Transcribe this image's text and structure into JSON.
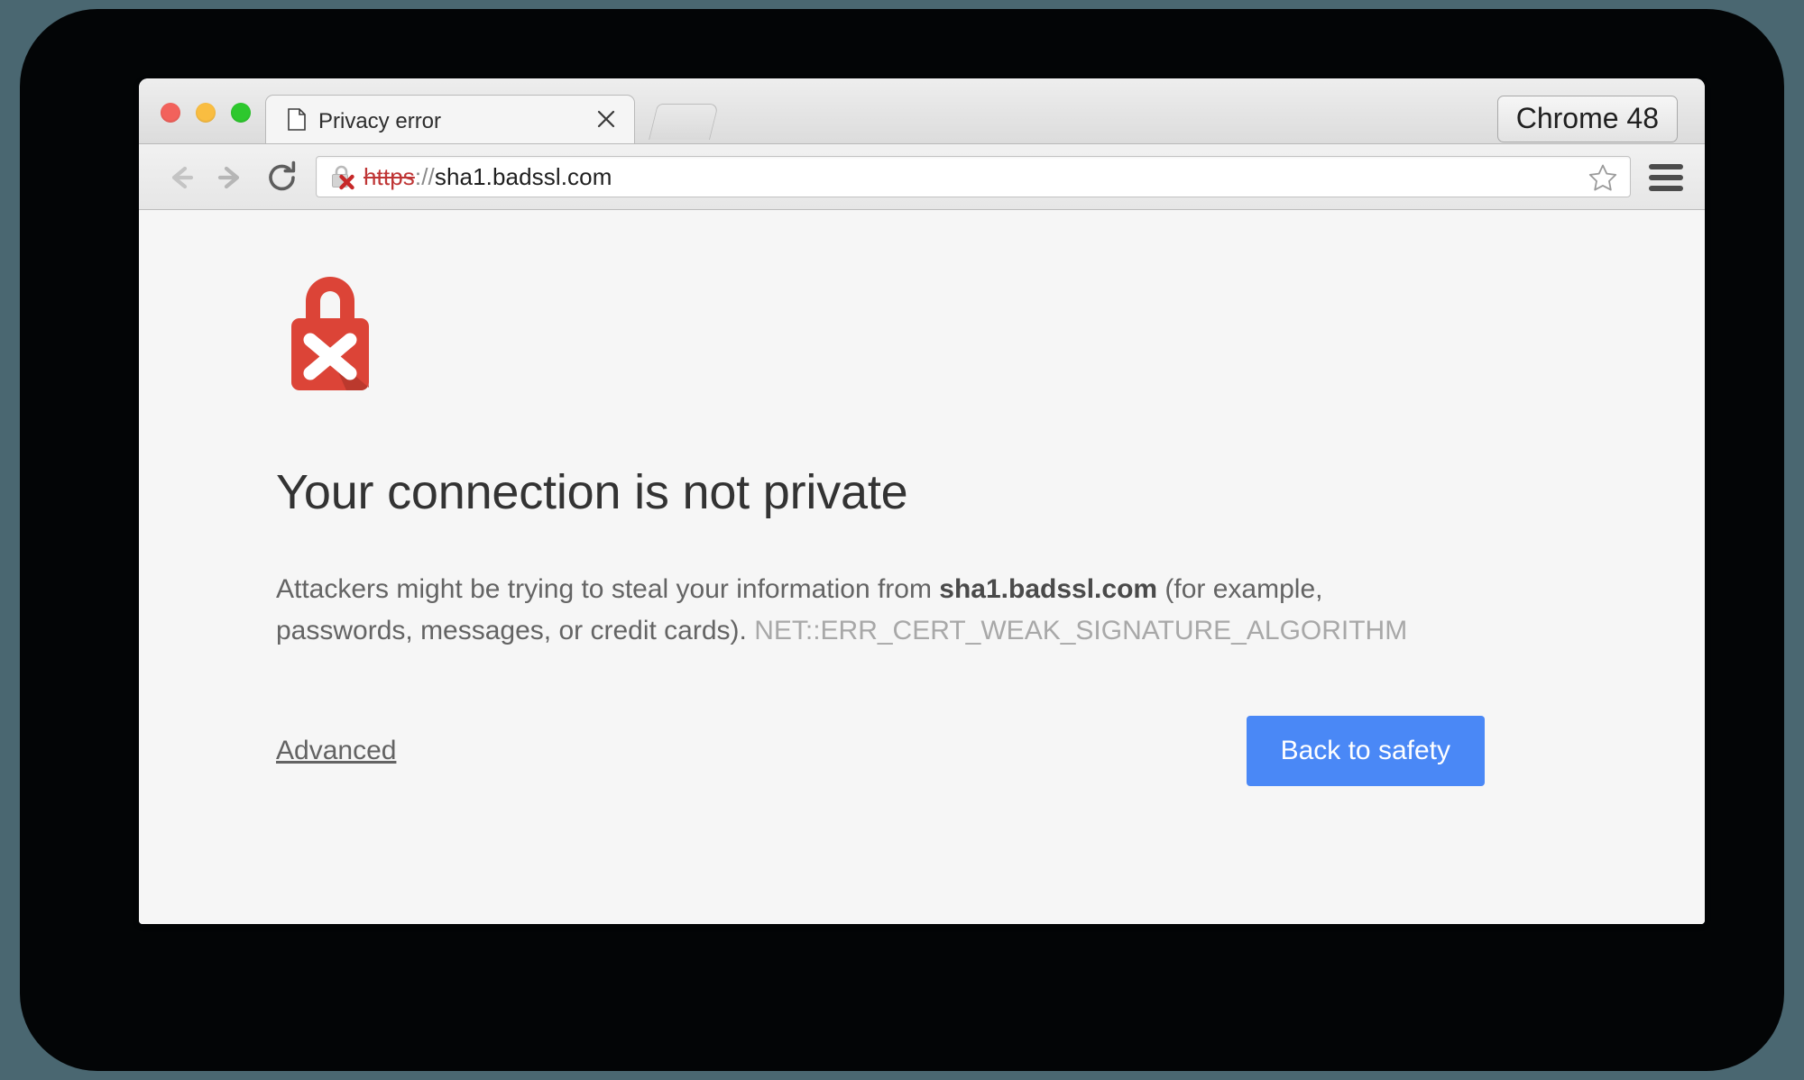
{
  "window": {
    "traffic_lights": [
      {
        "name": "close",
        "color": "#f2625c"
      },
      {
        "name": "minimize",
        "color": "#f9bd41"
      },
      {
        "name": "zoom",
        "color": "#2dc82d"
      }
    ]
  },
  "tab_strip": {
    "tab": {
      "title": "Privacy error",
      "favicon": "page-icon",
      "close_label": "×"
    },
    "new_tab_label": "+"
  },
  "toolbar": {
    "back_label": "←",
    "forward_label": "→",
    "reload_label": "↻",
    "omnibox": {
      "security_icon": "broken-lock-icon",
      "scheme": "https",
      "separator": "://",
      "host": "sha1.badssl.com",
      "full_url": "https://sha1.badssl.com"
    },
    "bookmark_label": "☆",
    "menu_label": "☰"
  },
  "version_badge": {
    "label": "Chrome 48"
  },
  "interstitial": {
    "icon": "broken-lock-icon",
    "heading": "Your connection is not private",
    "body_before_host": "Attackers might be trying to steal your information from ",
    "host": "sha1.badssl.com",
    "body_after_host": " (for example, passwords, messages, or credit cards). ",
    "error_code": "NET::ERR_CERT_WEAK_SIGNATURE_ALGORITHM",
    "advanced_label": "Advanced",
    "primary_button_label": "Back to safety"
  },
  "colors": {
    "accent_blue": "#4a88f6",
    "danger_red": "#dc4437",
    "scheme_red": "#bf3535",
    "page_background": "#f6f6f6",
    "bezel": "#030506",
    "desktop": "#4a6771"
  }
}
